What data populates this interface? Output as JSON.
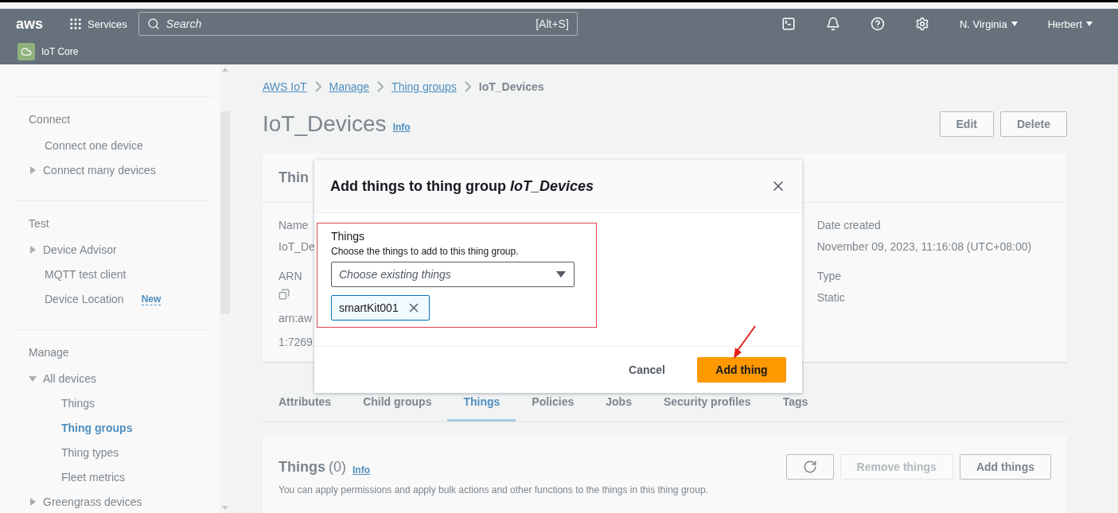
{
  "top_bar": {
    "logo": "aws",
    "services": "Services",
    "search": {
      "placeholder": "Search",
      "shortcut": "[Alt+S]"
    },
    "region": "N. Virginia",
    "user": "Herbert",
    "service_badge": "IoT Core"
  },
  "sidebar": {
    "sections": [
      {
        "title": "Connect",
        "items": [
          {
            "label": "Connect one device",
            "kind": "link",
            "selected": false
          },
          {
            "label": "Connect many devices",
            "kind": "group",
            "expanded": false
          }
        ]
      },
      {
        "title": "Test",
        "items": [
          {
            "label": "Device Advisor",
            "kind": "group",
            "expanded": false
          },
          {
            "label": "MQTT test client",
            "kind": "link",
            "selected": false
          },
          {
            "label": "Device Location",
            "kind": "link",
            "selected": false,
            "badge": "New"
          }
        ]
      },
      {
        "title": "Manage",
        "items": [
          {
            "label": "All devices",
            "kind": "group",
            "expanded": true,
            "children": [
              {
                "label": "Things",
                "selected": false
              },
              {
                "label": "Thing groups",
                "selected": true
              },
              {
                "label": "Thing types",
                "selected": false
              },
              {
                "label": "Fleet metrics",
                "selected": false
              }
            ]
          },
          {
            "label": "Greengrass devices",
            "kind": "group",
            "expanded": false
          }
        ]
      }
    ]
  },
  "breadcrumbs": [
    {
      "label": "AWS IoT",
      "kind": "link"
    },
    {
      "label": "Manage",
      "kind": "link"
    },
    {
      "label": "Thing groups",
      "kind": "link"
    },
    {
      "label": "IoT_Devices",
      "kind": "current"
    }
  ],
  "page": {
    "title": "IoT_Devices",
    "info": "Info",
    "buttons": [
      "Edit",
      "Delete"
    ]
  },
  "details": {
    "title": "Thin",
    "left": [
      {
        "label": "Name",
        "lines": [
          "IoT_De"
        ]
      },
      {
        "label": "ARN",
        "copy": true,
        "lines": [
          "arn:aw",
          "1:7269"
        ]
      }
    ],
    "right": [
      {
        "label": "Date created",
        "lines": [
          "November 09, 2023, 11:16:08 (UTC+08:00)"
        ]
      },
      {
        "label": "Type",
        "lines": [
          "Static"
        ]
      }
    ]
  },
  "tabs": [
    {
      "label": "Attributes",
      "selected": false
    },
    {
      "label": "Child groups",
      "selected": false
    },
    {
      "label": "Things",
      "selected": true
    },
    {
      "label": "Policies",
      "selected": false
    },
    {
      "label": "Jobs",
      "selected": false
    },
    {
      "label": "Security profiles",
      "selected": false
    },
    {
      "label": "Tags",
      "selected": false
    }
  ],
  "things_panel": {
    "title": "Things",
    "count": "(0)",
    "info": "Info",
    "description": "You can apply permissions and apply bulk actions and other functions to the things in this thing group.",
    "buttons": [
      {
        "label": "Remove things",
        "disabled": true
      },
      {
        "label": "Add things",
        "disabled": false
      }
    ]
  },
  "modal": {
    "title": "Add things to thing group *IoT_Devices*",
    "field": {
      "label": "Things",
      "description": "Choose the things to add to this thing group.",
      "placeholder": "Choose existing things",
      "tokens": [
        {
          "label": "smartKit001"
        }
      ]
    },
    "cancel": "Cancel",
    "primary": "Add thing"
  }
}
